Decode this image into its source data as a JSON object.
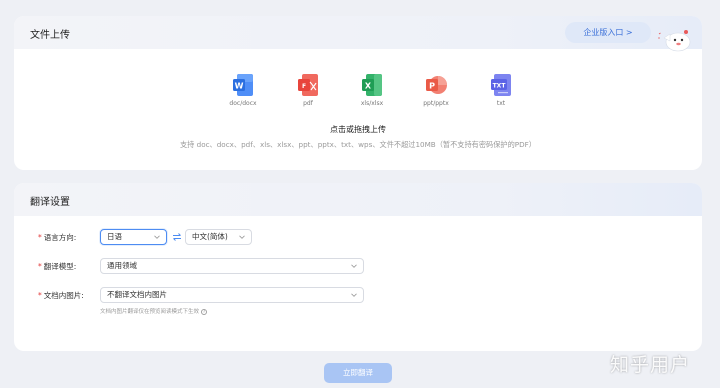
{
  "upload": {
    "title": "文件上传",
    "enterprise_label": "企业版入口 >",
    "formats": [
      {
        "label": "doc/docx",
        "icon": "word-icon",
        "color": "#2b6fe0",
        "glyph": "W"
      },
      {
        "label": "pdf",
        "icon": "pdf-icon",
        "color": "#e8453c",
        "glyph": "PDF"
      },
      {
        "label": "xls/xlsx",
        "icon": "excel-icon",
        "color": "#1f9d55",
        "glyph": "X"
      },
      {
        "label": "ppt/pptx",
        "icon": "powerpoint-icon",
        "color": "#ea5a47",
        "glyph": "P"
      },
      {
        "label": "txt",
        "icon": "txt-icon",
        "color": "#5b63e6",
        "glyph": "TXT"
      }
    ],
    "action_text": "点击或拖拽上传",
    "hint": "支持 doc、docx、pdf、xls、xlsx、ppt、pptx、txt、wps、文件不超过10MB（暂不支持有密码保护的PDF）"
  },
  "settings": {
    "title": "翻译设置",
    "language": {
      "label": "语言方向:",
      "source": "日语",
      "target": "中文(简体)"
    },
    "model": {
      "label": "翻译模型:",
      "value": "通用领域"
    },
    "images": {
      "label": "文档内图片:",
      "value": "不翻译文档内图片",
      "note": "文档内图片翻译仅在预览阅读模式下生效",
      "info": "?"
    }
  },
  "submit_label": "立即翻译",
  "watermark": "知乎用户",
  "colors": {
    "accent": "#4d8cf2",
    "required": "#e23b3b",
    "submit_disabled": "#a9c5f4"
  }
}
